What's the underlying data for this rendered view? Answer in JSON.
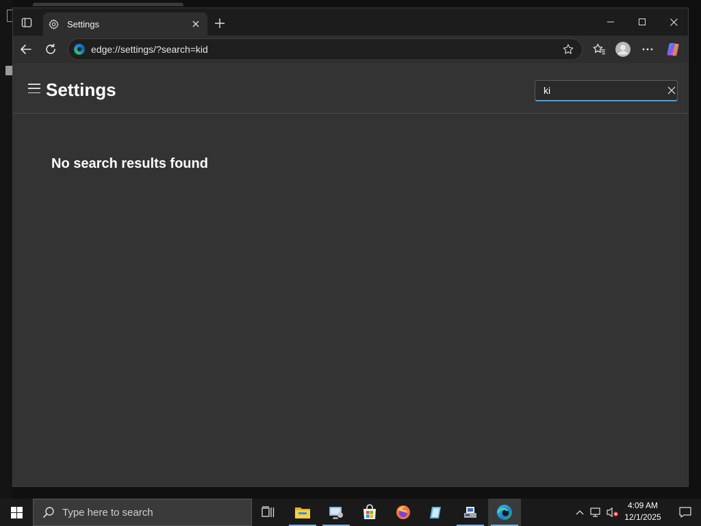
{
  "browser": {
    "tab": {
      "title": "Settings",
      "icon": "gear-icon"
    },
    "address": {
      "url": "edge://settings/?search=kid"
    },
    "window_controls": [
      "minimize",
      "maximize",
      "close"
    ],
    "toolbar_icons": [
      "back-icon",
      "refresh-icon",
      "favorites-star-icon",
      "collections-icon",
      "profile-icon",
      "more-icon",
      "copilot-icon"
    ]
  },
  "settings": {
    "title": "Settings",
    "search": {
      "value": "ki",
      "placeholder": ""
    },
    "empty_message": "No search results found"
  },
  "taskbar": {
    "search_placeholder": "Type here to search",
    "apps": [
      "task-view",
      "file-explorer",
      "control-panel",
      "microsoft-store",
      "firefox",
      "notepad",
      "network-app",
      "edge"
    ],
    "clock": {
      "time": "4:09 AM",
      "date": "12/1/2025"
    }
  },
  "colors": {
    "accent": "#4aa0e6",
    "content_bg": "#333333",
    "tabbar_bg": "#1c1c1c",
    "taskbar_bg": "#1a1a1a"
  }
}
